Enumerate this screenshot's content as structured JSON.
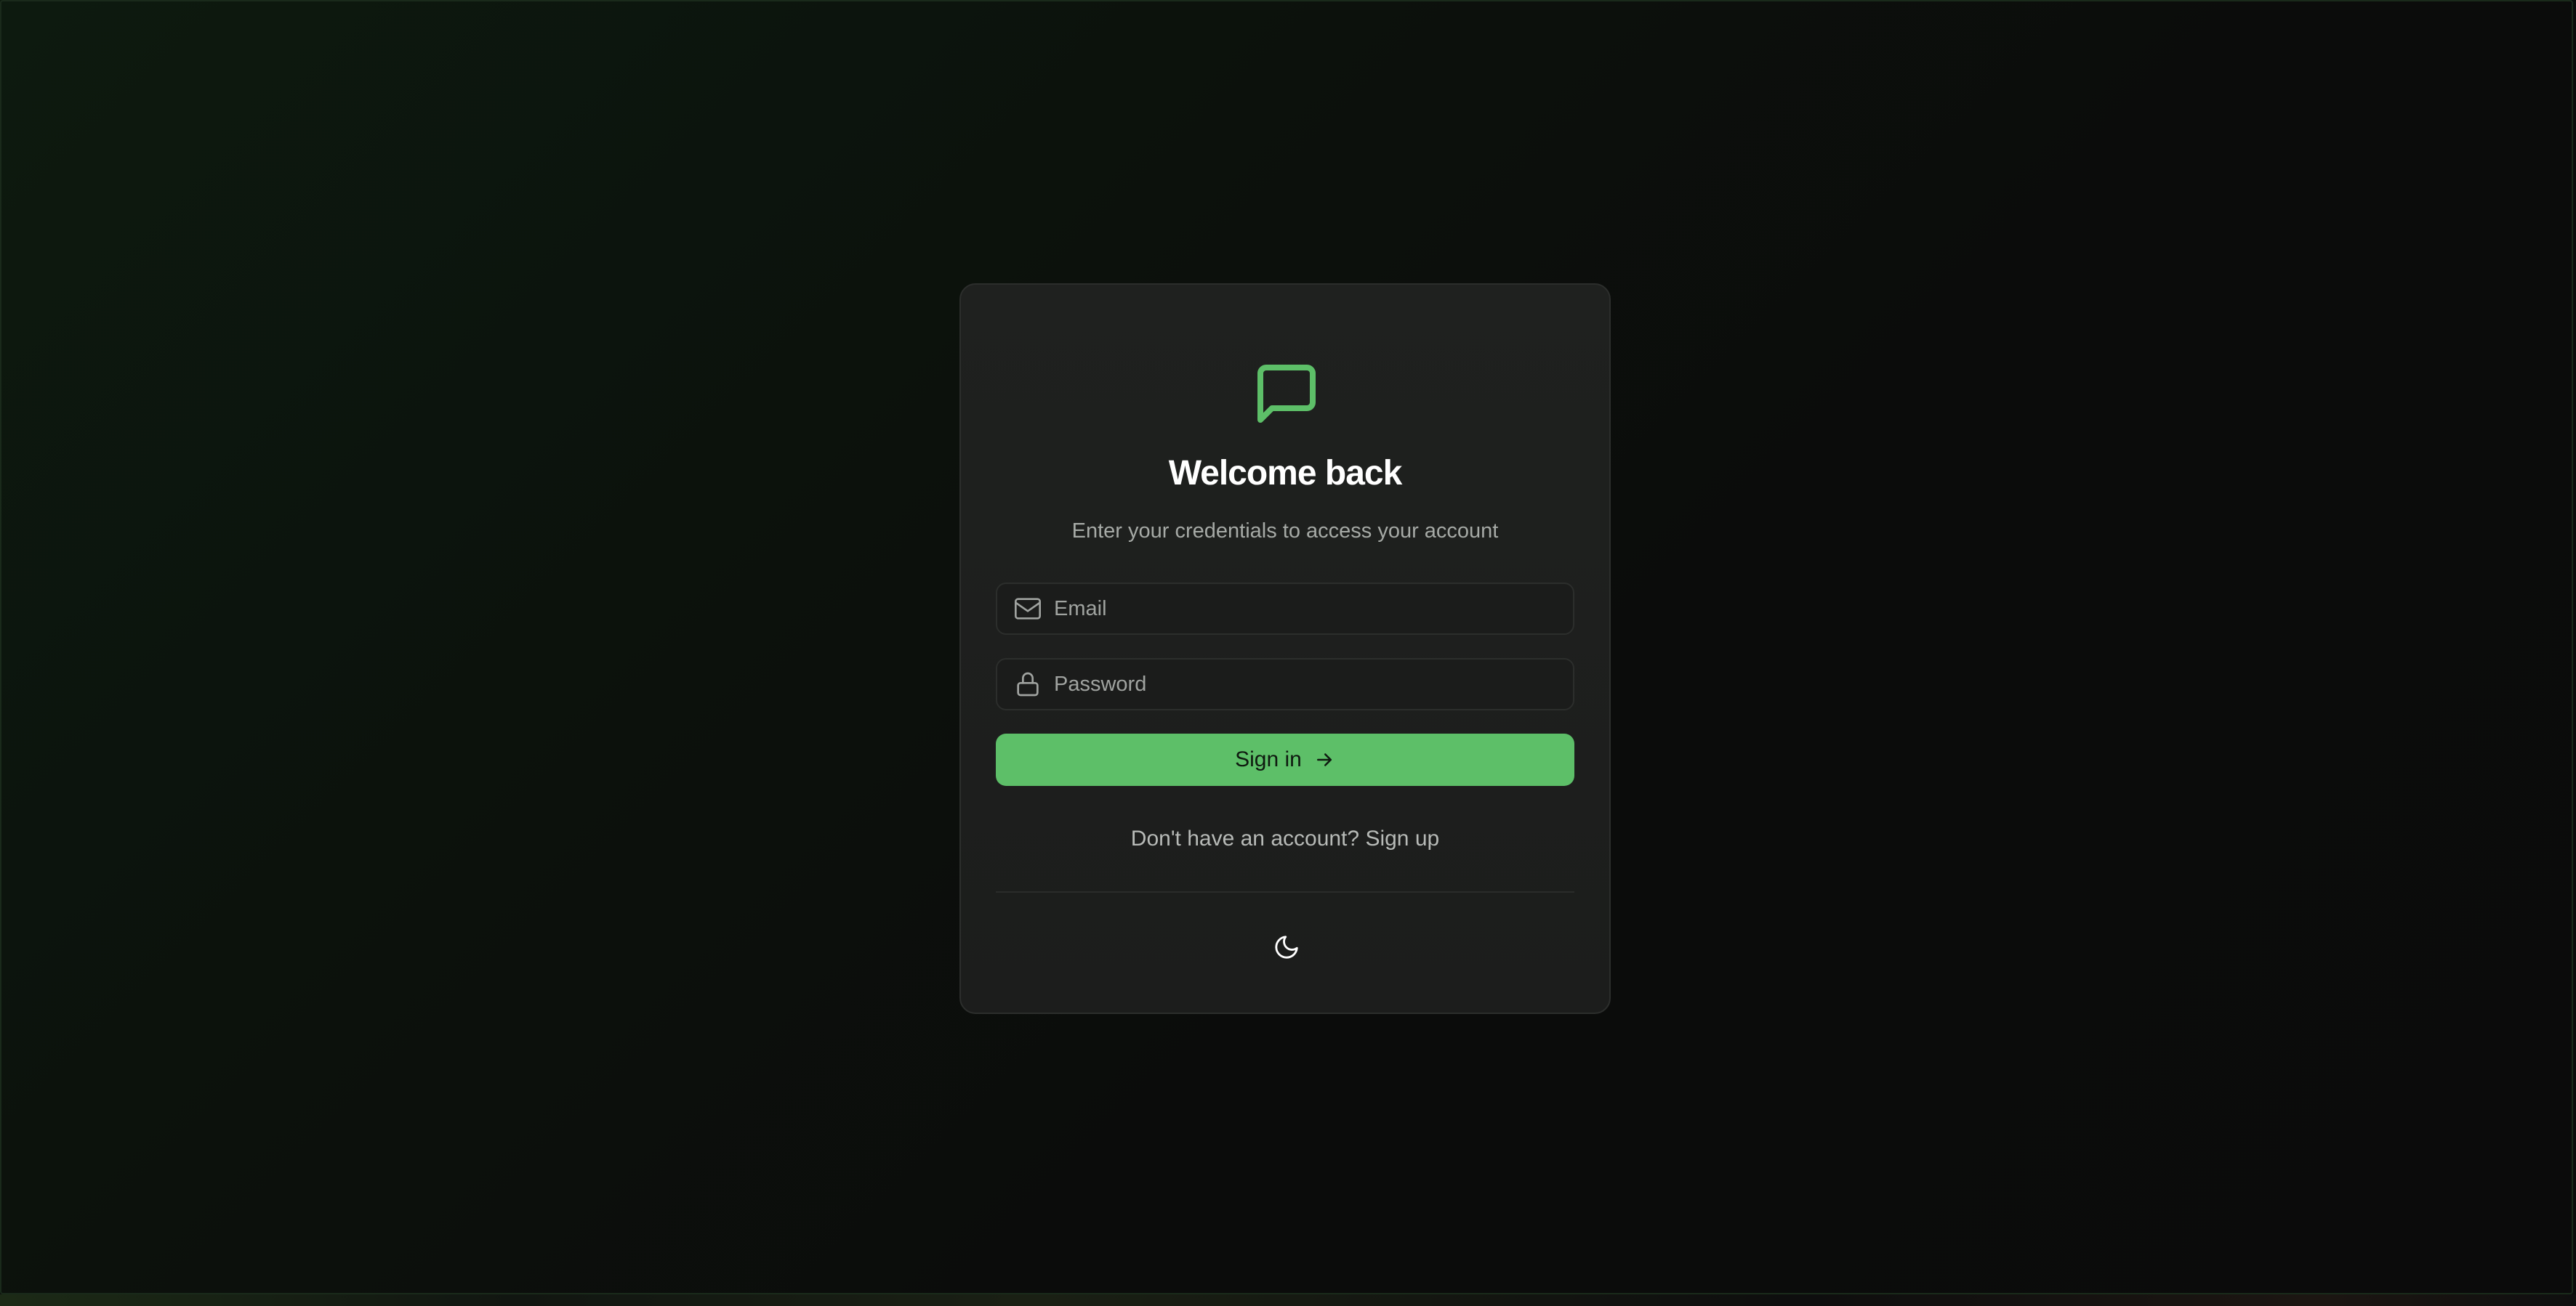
{
  "colors": {
    "accent": "#5dbf68",
    "background": "#0b0c0b",
    "card": "#1e1f1e",
    "text_primary": "#ffffff",
    "text_secondary": "#a6aaa6"
  },
  "login": {
    "logo_icon": "message-square-icon",
    "title": "Welcome back",
    "subtitle": "Enter your credentials to access your account",
    "email": {
      "icon": "mail-icon",
      "placeholder": "Email",
      "value": ""
    },
    "password": {
      "icon": "lock-icon",
      "placeholder": "Password",
      "value": ""
    },
    "submit": {
      "label": "Sign in",
      "icon": "arrow-right-icon"
    },
    "signup": {
      "prompt": "Don't have an account?",
      "link_label": "Sign up"
    },
    "theme_toggle_icon": "moon-icon"
  }
}
